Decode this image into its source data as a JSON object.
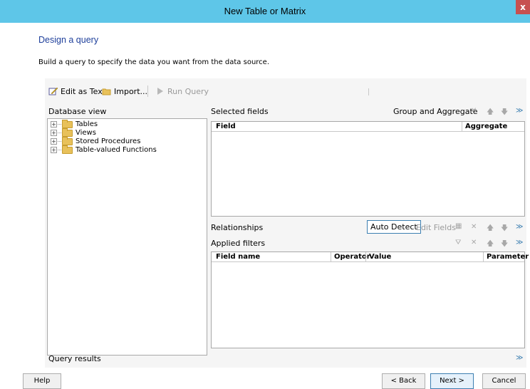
{
  "window": {
    "title": "New Table or Matrix",
    "close_label": "x"
  },
  "page": {
    "heading": "Design a query",
    "subtext": "Build a query to specify the data you want from the data source."
  },
  "toolbar": {
    "edit_as_text": "Edit as Text",
    "import": "Import...",
    "run_query": "Run Query"
  },
  "database_view": {
    "label": "Database view",
    "items": [
      {
        "label": "Tables"
      },
      {
        "label": "Views"
      },
      {
        "label": "Stored Procedures"
      },
      {
        "label": "Table-valued Functions"
      }
    ]
  },
  "selected_fields": {
    "label": "Selected fields",
    "group_and_aggregate": "Group and Aggregate",
    "columns": [
      "Field",
      "Aggregate"
    ]
  },
  "relationships": {
    "label": "Relationships",
    "auto_detect": "Auto Detect",
    "edit_fields": "Edit Fields"
  },
  "applied_filters": {
    "label": "Applied filters",
    "columns": [
      "Field name",
      "Operator",
      "Value",
      "Parameter"
    ]
  },
  "query_results": {
    "label": "Query results"
  },
  "footer": {
    "help": "Help",
    "back": "< Back",
    "next": "Next >",
    "cancel": "Cancel"
  },
  "icons": {
    "delete": "delete-icon",
    "move_up": "arrow-up-icon",
    "move_down": "arrow-down-icon",
    "collapse": "collapse-icon",
    "expand": "expand-icon",
    "filter": "filter-icon"
  },
  "colors": {
    "titlebar": "#5ec6e8",
    "heading": "#1e3f9b",
    "close": "#c75050"
  }
}
